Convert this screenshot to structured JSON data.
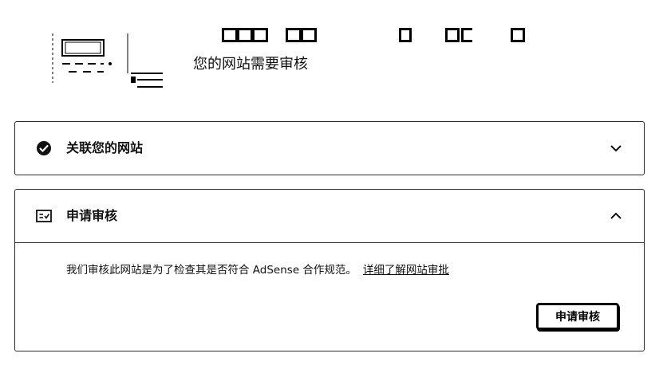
{
  "header": {
    "subtitle": "您的网站需要审核"
  },
  "cards": [
    {
      "title": "关联您的网站",
      "icon": "check-circle-icon",
      "expanded": false
    },
    {
      "title": "申请审核",
      "icon": "checklist-icon",
      "expanded": true,
      "description": "我们审核此网站是为了检查其是否符合 AdSense 合作规范。",
      "link_label": "详细了解网站审批",
      "button_label": "申请审核"
    }
  ]
}
